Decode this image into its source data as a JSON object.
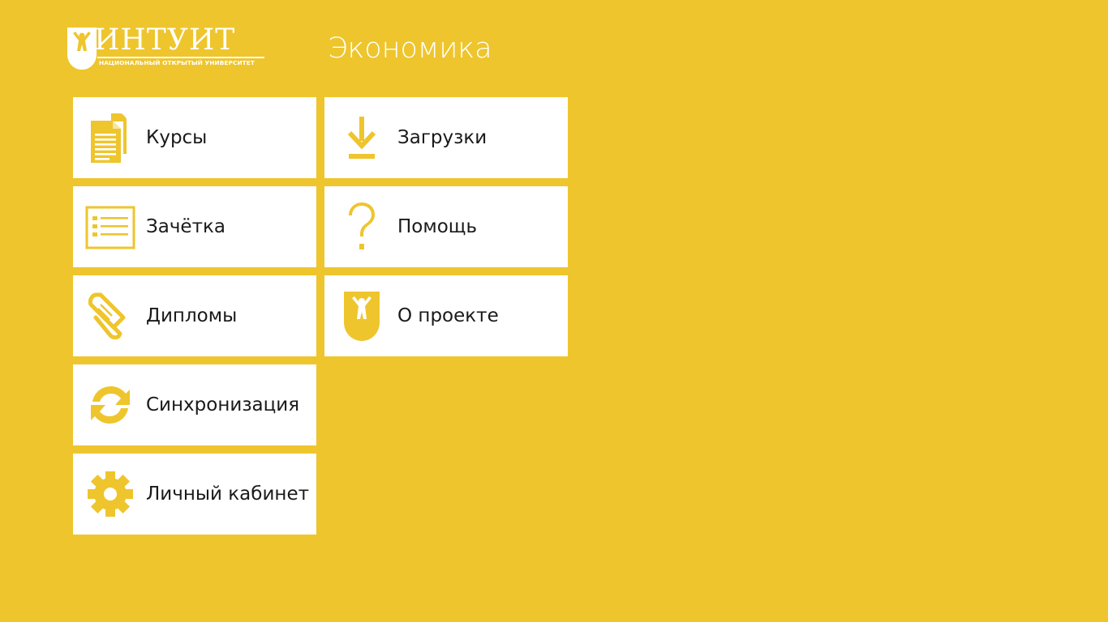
{
  "app": {
    "logo_name": "ИНТУИТ",
    "logo_subtitle": "НАЦИОНАЛЬНЫЙ ОТКРЫТЫЙ УНИВЕРСИТЕТ",
    "page_title": "Экономика"
  },
  "colors": {
    "background": "#EEC52D",
    "accent": "#EEC52D",
    "tile": "#FFFFFF",
    "text": "#1A1A1A"
  },
  "tiles": [
    {
      "label": "Курсы",
      "icon": "documents-icon"
    },
    {
      "label": "Зачётка",
      "icon": "list-icon"
    },
    {
      "label": "Дипломы",
      "icon": "diploma-scroll-icon"
    },
    {
      "label": "Синхронизация",
      "icon": "sync-icon"
    },
    {
      "label": "Личный кабинет",
      "icon": "gear-icon"
    },
    {
      "label": "Загрузки",
      "icon": "download-icon"
    },
    {
      "label": "Помощь",
      "icon": "question-icon"
    },
    {
      "label": "О проекте",
      "icon": "intuit-shield-icon"
    }
  ]
}
